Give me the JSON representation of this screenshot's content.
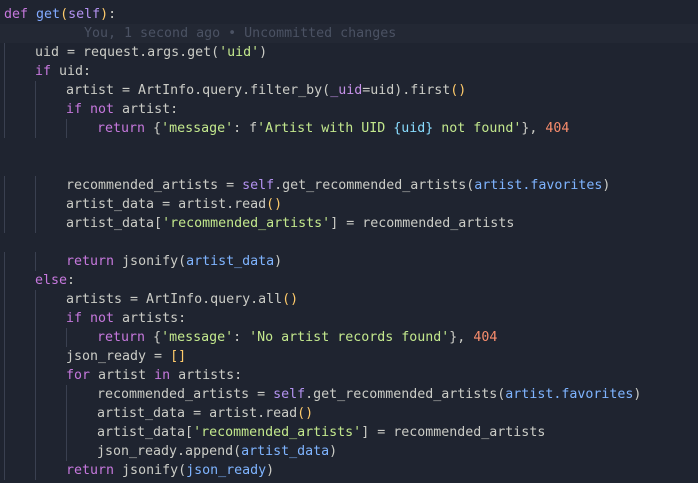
{
  "blame": "You, 1 second ago • Uncommitted changes",
  "lines": [
    {
      "indent": 0,
      "tokens": [
        [
          "def",
          "kw2"
        ],
        [
          " ",
          ""
        ],
        [
          "get",
          "fn"
        ],
        [
          "(",
          "pun"
        ],
        [
          "self",
          "self"
        ],
        [
          ")",
          "pun"
        ],
        [
          ":",
          ""
        ]
      ]
    },
    {
      "indent": 0,
      "blame": true,
      "tokens": []
    },
    {
      "indent": 1,
      "tokens": [
        [
          "uid = request.args.get(",
          ""
        ],
        [
          "'uid'",
          "str"
        ],
        [
          ")",
          ""
        ]
      ]
    },
    {
      "indent": 1,
      "tokens": [
        [
          "if",
          "kw2"
        ],
        [
          " uid:",
          ""
        ]
      ]
    },
    {
      "indent": 2,
      "tokens": [
        [
          "artist = ArtInfo.query.filter_by(",
          ""
        ],
        [
          "_uid",
          "prm"
        ],
        [
          "=uid).first",
          ""
        ],
        [
          "()",
          "pun"
        ]
      ]
    },
    {
      "indent": 2,
      "tokens": [
        [
          "if not",
          "kw2"
        ],
        [
          " artist:",
          ""
        ]
      ]
    },
    {
      "indent": 3,
      "tokens": [
        [
          "return",
          "kw2"
        ],
        [
          " {",
          ""
        ],
        [
          "'message'",
          "str"
        ],
        [
          ": f",
          ""
        ],
        [
          "'Artist with UID ",
          "str"
        ],
        [
          "{uid}",
          "op"
        ],
        [
          " not found'",
          "str"
        ],
        [
          "}, ",
          ""
        ],
        [
          "404",
          "num"
        ]
      ]
    },
    {
      "indent": 0,
      "tokens": []
    },
    {
      "indent": 0,
      "tokens": []
    },
    {
      "indent": 2,
      "tokens": [
        [
          "recommended_artists = ",
          ""
        ],
        [
          "self",
          "self"
        ],
        [
          ".get_recommended_artists(",
          ""
        ],
        [
          "artist.favorites",
          "attr"
        ],
        [
          ")",
          ""
        ]
      ]
    },
    {
      "indent": 2,
      "tokens": [
        [
          "artist_data = artist.read",
          ""
        ],
        [
          "()",
          "pun"
        ]
      ]
    },
    {
      "indent": 2,
      "tokens": [
        [
          "artist_data[",
          ""
        ],
        [
          "'recommended_artists'",
          "str"
        ],
        [
          "] = recommended_artists",
          ""
        ]
      ]
    },
    {
      "indent": 0,
      "tokens": []
    },
    {
      "indent": 2,
      "tokens": [
        [
          "return",
          "kw2"
        ],
        [
          " jsonify(",
          ""
        ],
        [
          "artist_data",
          "attr"
        ],
        [
          ")",
          ""
        ]
      ]
    },
    {
      "indent": 1,
      "tokens": [
        [
          "else",
          "kw2"
        ],
        [
          ":",
          ""
        ]
      ]
    },
    {
      "indent": 2,
      "tokens": [
        [
          "artists = ArtInfo.query.all",
          ""
        ],
        [
          "()",
          "pun"
        ]
      ]
    },
    {
      "indent": 2,
      "tokens": [
        [
          "if not",
          "kw2"
        ],
        [
          " artists:",
          ""
        ]
      ]
    },
    {
      "indent": 3,
      "tokens": [
        [
          "return",
          "kw2"
        ],
        [
          " {",
          ""
        ],
        [
          "'message'",
          "str"
        ],
        [
          ": ",
          ""
        ],
        [
          "'No artist records found'",
          "str"
        ],
        [
          "}, ",
          ""
        ],
        [
          "404",
          "num"
        ]
      ]
    },
    {
      "indent": 2,
      "tokens": [
        [
          "json_ready = ",
          ""
        ],
        [
          "[]",
          "pun"
        ]
      ]
    },
    {
      "indent": 2,
      "tokens": [
        [
          "for",
          "kw2"
        ],
        [
          " artist ",
          ""
        ],
        [
          "in",
          "kw2"
        ],
        [
          " artists:",
          ""
        ]
      ]
    },
    {
      "indent": 3,
      "tokens": [
        [
          "recommended_artists = ",
          ""
        ],
        [
          "self",
          "self"
        ],
        [
          ".get_recommended_artists(",
          ""
        ],
        [
          "artist.favorites",
          "attr"
        ],
        [
          ")",
          ""
        ]
      ]
    },
    {
      "indent": 3,
      "tokens": [
        [
          "artist_data = artist.read",
          ""
        ],
        [
          "()",
          "pun"
        ]
      ]
    },
    {
      "indent": 3,
      "tokens": [
        [
          "artist_data[",
          ""
        ],
        [
          "'recommended_artists'",
          "str"
        ],
        [
          "] = recommended_artists",
          ""
        ]
      ]
    },
    {
      "indent": 3,
      "tokens": [
        [
          "json_ready.append(",
          ""
        ],
        [
          "artist_data",
          "attr"
        ],
        [
          ")",
          ""
        ]
      ]
    },
    {
      "indent": 2,
      "tokens": [
        [
          "return",
          "kw2"
        ],
        [
          " jsonify(",
          ""
        ],
        [
          "json_ready",
          "attr"
        ],
        [
          ")",
          ""
        ]
      ]
    }
  ]
}
